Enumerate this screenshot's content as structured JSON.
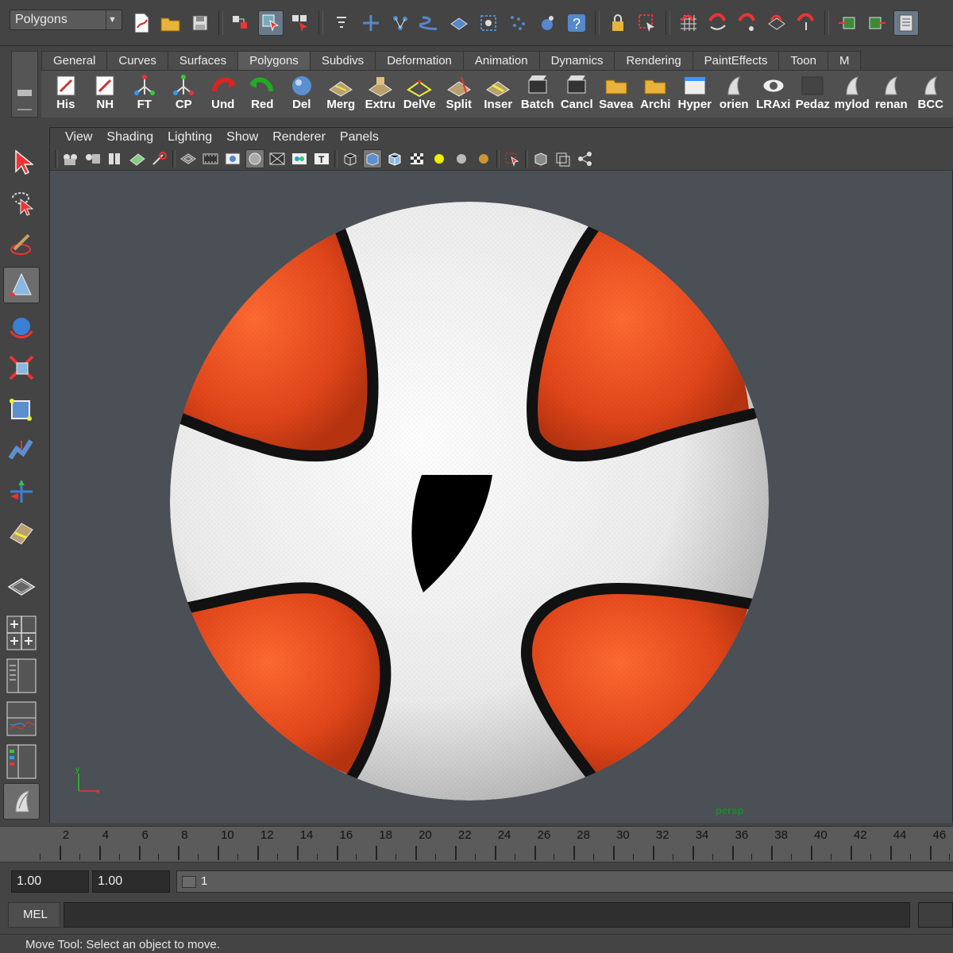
{
  "status_line": {
    "mode": "Polygons"
  },
  "shelf": {
    "tabs": [
      "General",
      "Curves",
      "Surfaces",
      "Polygons",
      "Subdivs",
      "Deformation",
      "Animation",
      "Dynamics",
      "Rendering",
      "PaintEffects",
      "Toon",
      "M"
    ],
    "active_tab": "Polygons",
    "buttons": [
      "His",
      "NH",
      "FT",
      "CP",
      "Und",
      "Red",
      "Del",
      "Merg",
      "Extru",
      "DelVe",
      "Split",
      "Inser",
      "Batch",
      "Cancl",
      "Savea",
      "Archi",
      "Hyper",
      "orien",
      "LRAxi",
      "Pedaz",
      "mylod",
      "renan",
      "BCC"
    ]
  },
  "panel": {
    "menus": [
      "View",
      "Shading",
      "Lighting",
      "Show",
      "Renderer",
      "Panels"
    ],
    "camera": "persp"
  },
  "axis": {
    "y": "y",
    "x": "x"
  },
  "colors": {
    "ball_orange": "#e2461a",
    "ball_white": "#f2f2f2",
    "seam": "#111111",
    "viewport_bg": "#4b4f56",
    "camera_label": "#1d8a2e"
  },
  "time_slider": {
    "labels": [
      "2",
      "4",
      "6",
      "8",
      "10",
      "12",
      "14",
      "16",
      "18",
      "20",
      "22",
      "24",
      "26",
      "28",
      "30",
      "32",
      "34",
      "36",
      "38",
      "40",
      "42",
      "44",
      "46"
    ]
  },
  "range_slider": {
    "start_time": "1.00",
    "start_range": "1.00",
    "current": "1"
  },
  "command_line": {
    "label": "MEL"
  },
  "help_line": {
    "text": "Move Tool: Select an object to move."
  }
}
